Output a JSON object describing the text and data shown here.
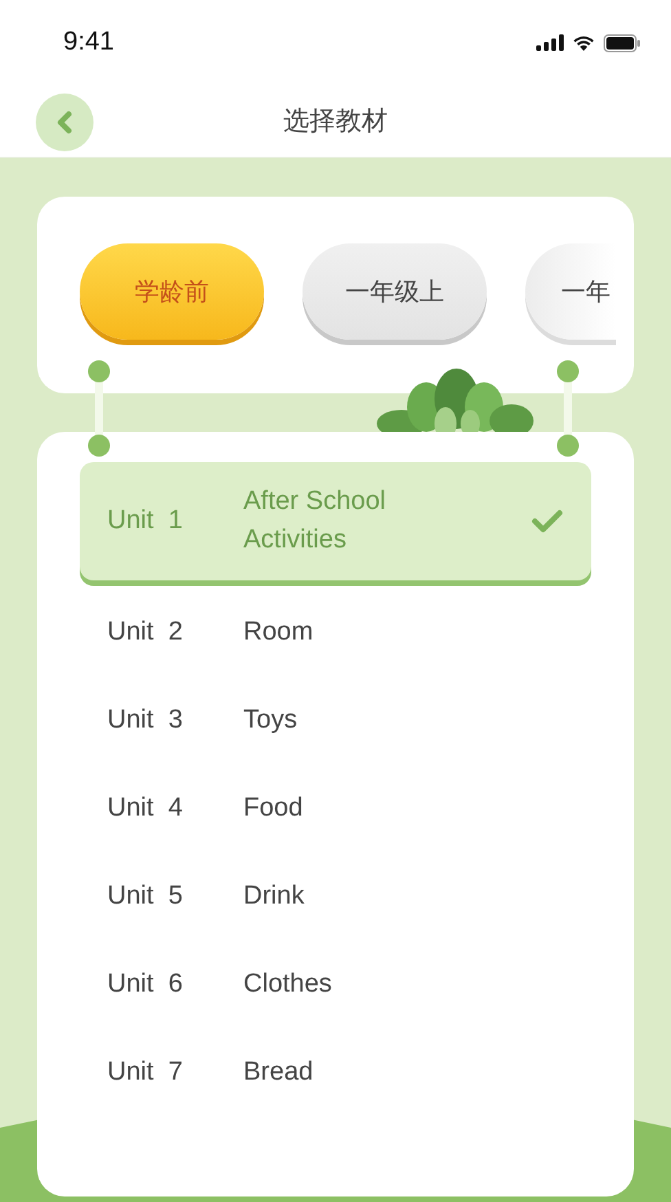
{
  "status_bar": {
    "time": "9:41"
  },
  "header": {
    "title": "选择教材"
  },
  "grades": [
    {
      "label": "学龄前",
      "selected": true
    },
    {
      "label": "一年级上",
      "selected": false
    },
    {
      "label": "一年",
      "selected": false
    }
  ],
  "units": [
    {
      "unit": "Unit  1",
      "title": "After School Activities",
      "selected": true
    },
    {
      "unit": "Unit  2",
      "title": "Room",
      "selected": false
    },
    {
      "unit": "Unit  3",
      "title": "Toys",
      "selected": false
    },
    {
      "unit": "Unit  4",
      "title": "Food",
      "selected": false
    },
    {
      "unit": "Unit  5",
      "title": "Drink",
      "selected": false
    },
    {
      "unit": "Unit  6",
      "title": "Clothes",
      "selected": false
    },
    {
      "unit": "Unit  7",
      "title": "Bread",
      "selected": false
    }
  ]
}
